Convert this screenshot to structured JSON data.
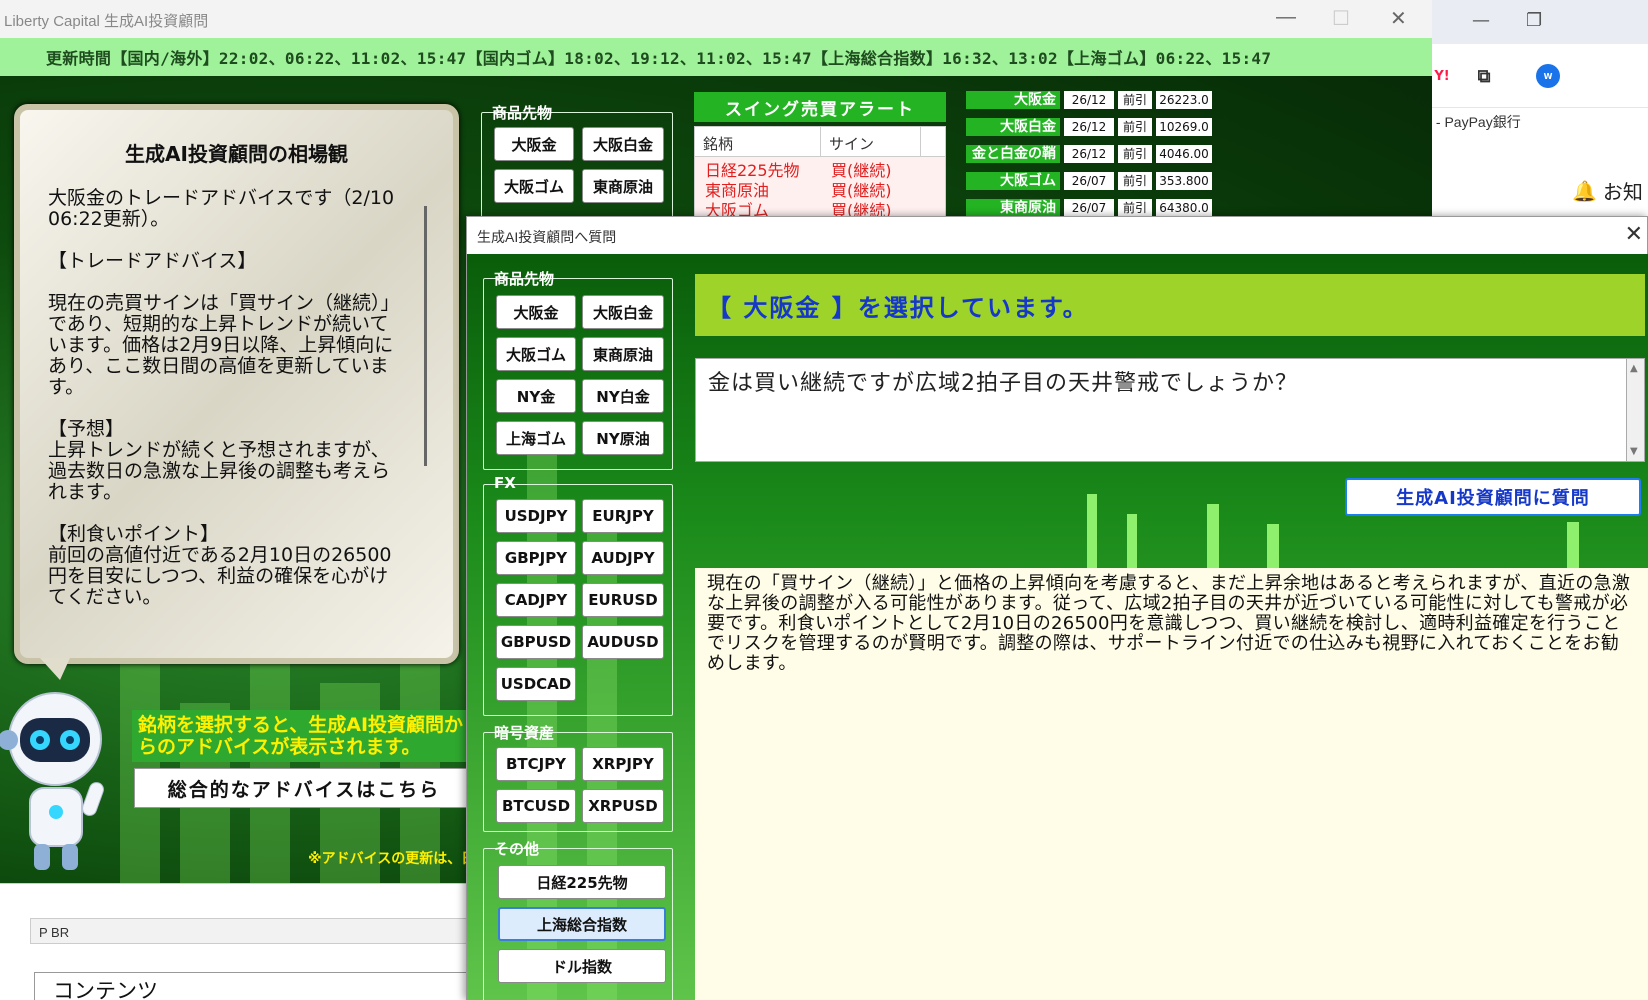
{
  "window": {
    "title": "Liberty Capital 生成AI投資顧問"
  },
  "update_times": "更新時間【国内/海外】22:02、06:22、11:02、15:47【国内ゴム】18:02、19:12、11:02、15:47【上海総合指数】16:32、13:02【上海ゴム】06:22、15:47",
  "advice_card": {
    "title": "生成AI投資顧問の相場観",
    "text": "大阪金のトレードアドバイスです（2/10 06:22更新）。\n\n【トレードアドバイス】\n\n現在の売買サインは「買サイン（継続）」であり、短期的な上昇トレンドが続いています。価格は2月9日以降、上昇傾向にあり、ここ数日間の高値を更新しています。\n\n【予想】\n上昇トレンドが続くと予想されますが、過去数日の急激な上昇後の調整も考えられます。\n\n【利食いポイント】\n前回の高値付近である2月10日の26500円を目安にしつつ、利益の確保を心がけてください。\n\n【仕込みポイント】"
  },
  "hint_text": "銘柄を選択すると、生成AI投資顧問からのアドバイスが表示されます。",
  "overall_button": "総合的なアドバイスはこちら",
  "note_text": "※アドバイスの更新は、日",
  "main_commodity": {
    "legend": "商品先物",
    "buttons": [
      "大阪金",
      "大阪白金",
      "大阪ゴム",
      "東商原油"
    ]
  },
  "alert": {
    "title": "スイング売買アラート",
    "headers": [
      "銘柄",
      "サイン"
    ],
    "rows": [
      {
        "name": "日経225先物",
        "sign": "買(継続)"
      },
      {
        "name": "東商原油",
        "sign": "買(継続)"
      },
      {
        "name": "大阪ゴム",
        "sign": "買(継続)"
      }
    ]
  },
  "quotes": [
    {
      "name": "大阪金",
      "month": "26/12",
      "tag": "前引",
      "value": "26223.0"
    },
    {
      "name": "大阪白金",
      "month": "26/12",
      "tag": "前引",
      "value": "10269.0"
    },
    {
      "name": "金と白金の鞘",
      "month": "26/12",
      "tag": "前引",
      "value": "4046.00"
    },
    {
      "name": "大阪ゴム",
      "month": "26/07",
      "tag": "前引",
      "value": "353.800"
    },
    {
      "name": "東商原油",
      "month": "26/07",
      "tag": "前引",
      "value": "64380.0"
    }
  ],
  "below": {
    "pbr": "P  BR",
    "contents": "コンテンツ"
  },
  "dialog": {
    "title": "生成AI投資顧問へ質問",
    "selection": "【 大阪金 】を選択しています。",
    "question": "金は買い継続ですが広域2拍子目の天井警戒でしょうか？",
    "ask_button": "生成AI投資顧問に質問",
    "answer": "現在の「買サイン（継続）」と価格の上昇傾向を考慮すると、まだ上昇余地はあると考えられますが、直近の急激な上昇後の調整が入る可能性があります。従って、広域2拍子目の天井が近づいている可能性に対しても警戒が必要です。利食いポイントとして2月10日の26500円を意識しつつ、買い継続を検討し、適時利益確定を行うことでリスクを管理するのが賢明です。調整の際は、サポートライン付近での仕込みも視野に入れておくことをお勧めします。",
    "groups": {
      "commodity": {
        "legend": "商品先物",
        "buttons": [
          "大阪金",
          "大阪白金",
          "大阪ゴム",
          "東商原油",
          "NY金",
          "NY白金",
          "上海ゴム",
          "NY原油"
        ]
      },
      "fx": {
        "legend": "FX",
        "buttons": [
          "USDJPY",
          "EURJPY",
          "GBPJPY",
          "AUDJPY",
          "CADJPY",
          "EURUSD",
          "GBPUSD",
          "AUDUSD",
          "USDCAD"
        ]
      },
      "crypto": {
        "legend": "暗号資産",
        "buttons": [
          "BTCJPY",
          "XRPJPY",
          "BTCUSD",
          "XRPUSD"
        ]
      },
      "other": {
        "legend": "その他",
        "buttons": [
          "日経225先物",
          "上海総合指数",
          "ドル指数"
        ]
      }
    }
  },
  "browser": {
    "bookmark": "ログイン - PayPay銀行",
    "notify": "お知"
  },
  "colors": {
    "accent_green": "#23b323",
    "update_bar": "#9ff29a",
    "selection_bar": "#9ed32a",
    "selection_text": "#1538c9",
    "alert_red": "#e02020",
    "hint_yellow": "#ffef00"
  }
}
